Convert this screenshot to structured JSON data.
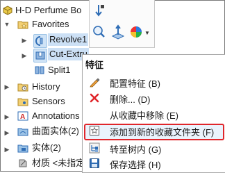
{
  "tree": {
    "root": "H-D Perfume Bo",
    "favorites": "Favorites",
    "revolve": "Revolve1",
    "cut_extrude": "Cut-Extru",
    "split": "Split1",
    "history": "History",
    "sensors": "Sensors",
    "annotations": "Annotations",
    "surface_bodies": "曲面实体(2)",
    "solid_bodies": "实体(2)",
    "material": "材质 <未指定"
  },
  "context_menu": {
    "title": "特征",
    "items": [
      {
        "label": "配置特征 (B)",
        "icon": "configure-feature-icon"
      },
      {
        "label": "删除... (D)",
        "icon": "delete-x-icon"
      },
      {
        "label": "从收藏中移除 (E)",
        "icon": ""
      },
      {
        "label": "添加到新的收藏文件夹 (F)",
        "icon": "add-to-favorites-folder-icon"
      },
      {
        "label": "转至树内 (G)",
        "icon": "go-to-tree-icon"
      },
      {
        "label": "保存选择 (H)",
        "icon": "save-selection-icon"
      }
    ]
  },
  "colors": {
    "highlight_border": "#e0262b",
    "selection": "#cfe3f6"
  }
}
